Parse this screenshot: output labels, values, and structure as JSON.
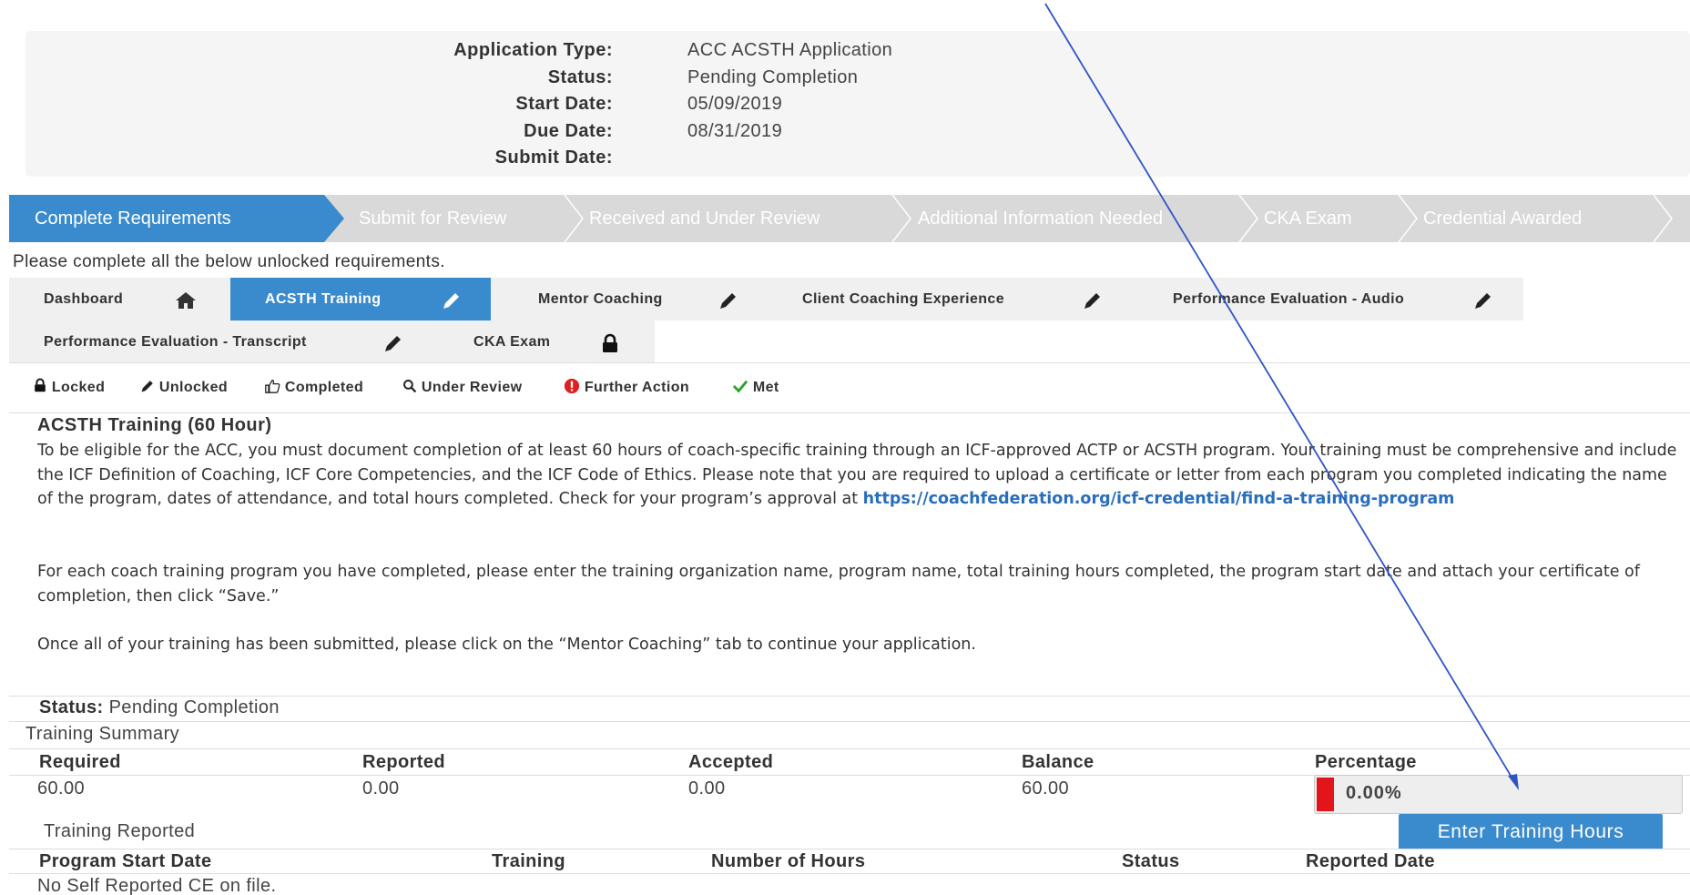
{
  "application_info": {
    "rows": [
      {
        "label": "Application Type:",
        "value": "ACC ACSTH Application"
      },
      {
        "label": "Status:",
        "value": "Pending Completion"
      },
      {
        "label": "Start Date:",
        "value": "05/09/2019"
      },
      {
        "label": "Due Date:",
        "value": "08/31/2019"
      },
      {
        "label": "Submit Date:",
        "value": ""
      }
    ]
  },
  "progress_steps": [
    {
      "label": "Complete Requirements",
      "active": true
    },
    {
      "label": "Submit for Review",
      "active": false
    },
    {
      "label": "Received and Under Review",
      "active": false
    },
    {
      "label": "Additional Information Needed",
      "active": false
    },
    {
      "label": "CKA Exam",
      "active": false
    },
    {
      "label": "Credential Awarded",
      "active": false
    }
  ],
  "instructions": "Please complete all the below unlocked requirements.",
  "tabs": [
    {
      "label": "Dashboard",
      "icon": "home-icon"
    },
    {
      "label": "ACSTH Training",
      "icon": "pencil-icon",
      "active": true
    },
    {
      "label": "Mentor Coaching",
      "icon": "pencil-icon"
    },
    {
      "label": "Client Coaching Experience",
      "icon": "pencil-icon"
    },
    {
      "label": "Performance Evaluation - Audio",
      "icon": "pencil-icon"
    },
    {
      "label": "Performance Evaluation - Transcript",
      "icon": "pencil-icon"
    },
    {
      "label": "CKA Exam",
      "icon": "lock-icon"
    }
  ],
  "legend": [
    {
      "label": "Locked",
      "icon": "lock-icon"
    },
    {
      "label": "Unlocked",
      "icon": "pencil-icon"
    },
    {
      "label": "Completed",
      "icon": "thumbs-up-icon"
    },
    {
      "label": "Under Review",
      "icon": "search-icon"
    },
    {
      "label": "Further Action",
      "icon": "alert-icon"
    },
    {
      "label": "Met",
      "icon": "check-icon"
    }
  ],
  "section": {
    "title": "ACSTH Training (60 Hour)",
    "para1": "To be eligible for the ACC, you must document completion of at least 60 hours of coach-specific training through an ICF-approved ACTP or ACSTH program. Your training must be comprehensive and include the ICF Definition of Coaching, ICF Core Competencies, and the ICF Code of Ethics. Please note that you are required to upload a certificate or letter from each program you completed indicating the name of the program, dates of attendance, and total hours completed. Check for your program’s approval at",
    "link": "https://coachfederation.org/icf-credential/find-a-training-program",
    "para2": "For each coach training program you have completed, please enter the training organization name, program name, total training hours completed, the program start date and attach your certificate of completion, then click “Save.”",
    "para3": "Once all of your training has been submitted, please click on the “Mentor Coaching” tab to continue your application."
  },
  "status": {
    "label": "Status:",
    "value": "Pending Completion"
  },
  "training_summary": {
    "title": "Training Summary",
    "columns": [
      "Required",
      "Reported",
      "Accepted",
      "Balance",
      "Percentage"
    ],
    "values": {
      "required": "60.00",
      "reported": "0.00",
      "accepted": "0.00",
      "balance": "60.00"
    },
    "percentage_text": "0.00%",
    "percentage_value": 0,
    "fill_color": "#e4141b"
  },
  "training_reported": {
    "title": "Training Reported",
    "button_label": "Enter Training Hours",
    "columns": [
      "Program Start Date",
      "Training",
      "Number of Hours",
      "Status",
      "Reported Date"
    ],
    "empty_message": "No Self Reported CE on file."
  },
  "colors": {
    "accent": "#3a8bce",
    "link": "#2a6ebb",
    "annotation_line": "#2f55c4"
  }
}
